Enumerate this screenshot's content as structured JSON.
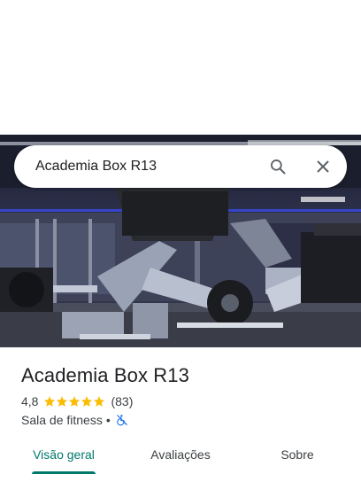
{
  "search": {
    "query": "Academia Box R13"
  },
  "place": {
    "name": "Academia Box R13",
    "rating": "4,8",
    "stars": 5,
    "reviews": "(83)",
    "category": "Sala de fitness",
    "separator": "•"
  },
  "tabs": [
    {
      "label": "Visão geral",
      "active": true
    },
    {
      "label": "Avaliações",
      "active": false
    },
    {
      "label": "Sobre",
      "active": false
    }
  ],
  "colors": {
    "accent": "#00796b",
    "star": "#fbbc04",
    "accessibility_icon": "#1a73e8"
  },
  "icons": {
    "search": "search-icon",
    "close": "close-icon",
    "accessibility": "wheelchair-not-accessible-icon"
  }
}
